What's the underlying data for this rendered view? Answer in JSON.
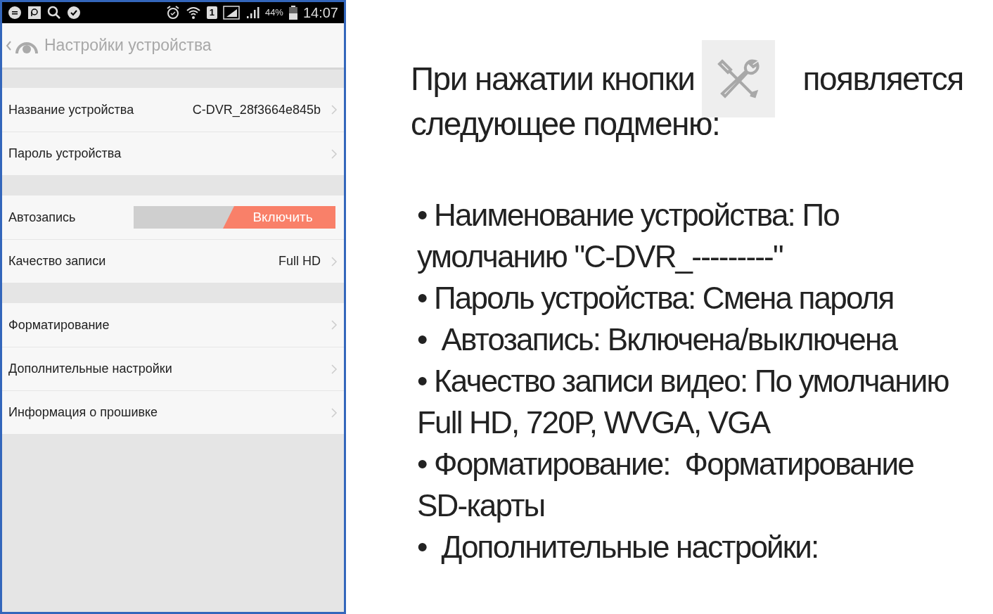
{
  "phone": {
    "status_bar": {
      "sim_slot": "1",
      "battery_percent": "44%",
      "time": "14:07"
    },
    "header": {
      "title": "Настройки устройства"
    },
    "groups": [
      {
        "rows": [
          {
            "kind": "link",
            "label": "Название устройства",
            "value": "C-DVR_28f3664e845b"
          },
          {
            "kind": "link",
            "label": "Пароль устройства"
          }
        ]
      },
      {
        "rows": [
          {
            "kind": "toggle",
            "label": "Автозапись",
            "button": "Включить",
            "on": true
          },
          {
            "kind": "link",
            "label": "Качество записи",
            "value": "Full HD"
          }
        ]
      },
      {
        "rows": [
          {
            "kind": "link",
            "label": "Форматирование"
          },
          {
            "kind": "link",
            "label": "Дополнительные настройки"
          },
          {
            "kind": "link",
            "label": "Информация о прошивке"
          }
        ]
      }
    ]
  },
  "description": {
    "intro_before": "При нажатии кнопки",
    "intro_after": "появляется",
    "intro_next": "следующее подменю:",
    "bullets": [
      "• Наименование устройства: По умолчанию \"C-DVR_---------\"",
      "• Пароль устройства: Смена пароля",
      "•  Автозапись: Включена/выключена",
      "• Качество записи видео: По умолчанию Full HD, 720P, WVGA, VGA",
      "• Форматирование:  Форматирование SD-карты",
      "•  Дополнительные настройки:"
    ]
  }
}
